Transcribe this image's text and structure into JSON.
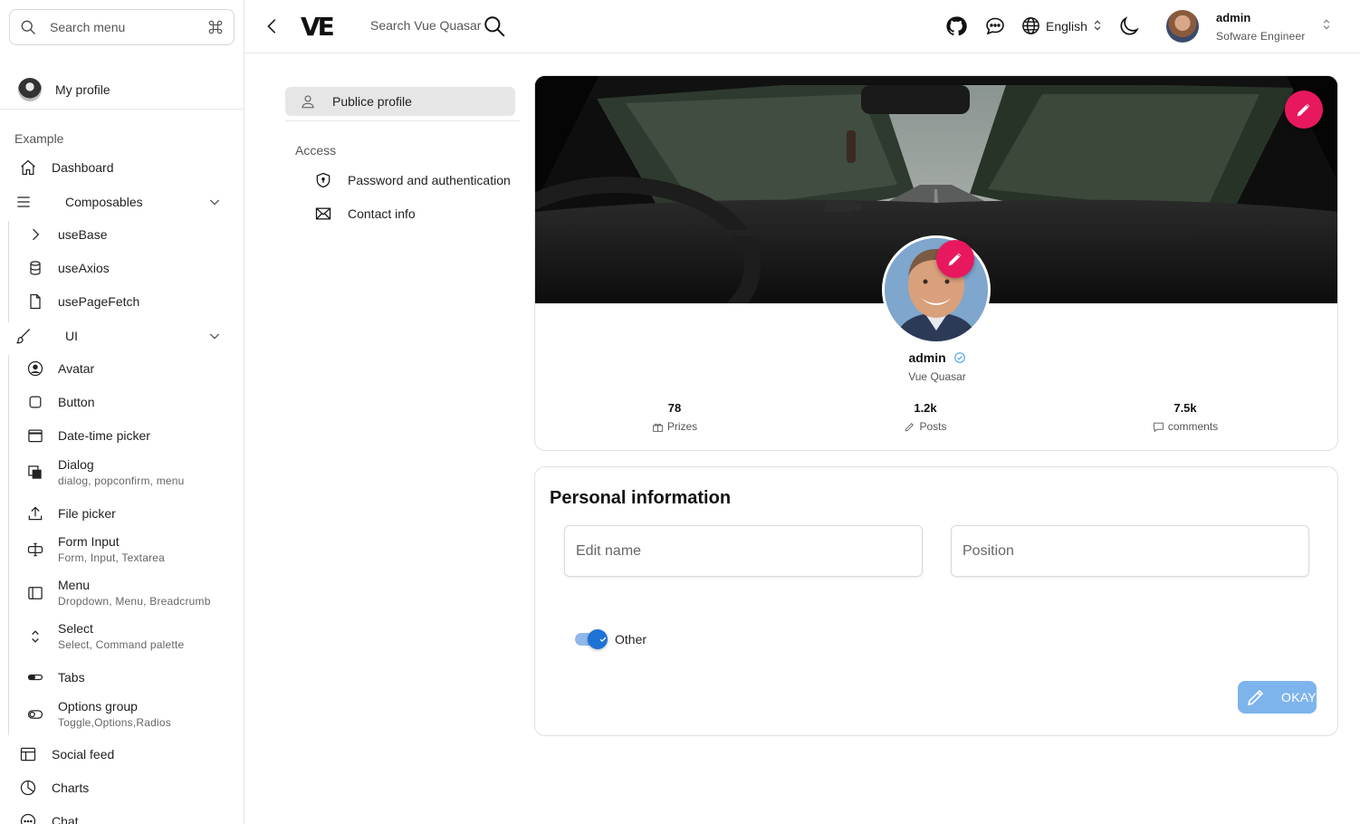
{
  "sidebar": {
    "search_placeholder": "Search menu",
    "profile_label": "My profile",
    "section_label": "Example",
    "items": {
      "dashboard": "Dashboard",
      "composables": "Composables",
      "use_base": "useBase",
      "use_axios": "useAxios",
      "use_page_fetch": "usePageFetch",
      "ui": "UI",
      "avatar": "Avatar",
      "button": "Button",
      "date_time_picker": "Date-time picker",
      "dialog": "Dialog",
      "dialog_sub": "dialog, popconfirm, menu",
      "file_picker": "File picker",
      "form_input": "Form Input",
      "form_input_sub": "Form, Input, Textarea",
      "menu": "Menu",
      "menu_sub": "Dropdown, Menu, Breadcrumb",
      "select": "Select",
      "select_sub": "Select, Command palette",
      "tabs": "Tabs",
      "options_group": "Options group",
      "options_group_sub": "Toggle,Options,Radios",
      "social_feed": "Social feed",
      "charts": "Charts",
      "chat": "Chat"
    }
  },
  "topbar": {
    "logo": "VE",
    "search_label": "Search Vue Quasar",
    "language": "English",
    "user_name": "admin",
    "user_role": "Sofware Engineer"
  },
  "settings_menu": {
    "active": "Publice profile",
    "section": "Access",
    "password": "Password and authentication",
    "contact": "Contact info"
  },
  "profile": {
    "name": "admin",
    "role": "Vue Quasar",
    "stats": [
      {
        "value": "78",
        "label": "Prizes"
      },
      {
        "value": "1.2k",
        "label": "Posts"
      },
      {
        "value": "7.5k",
        "label": "comments"
      }
    ]
  },
  "personal_info": {
    "title": "Personal information",
    "name_placeholder": "Edit name",
    "position_placeholder": "Position",
    "toggle_label": "Other",
    "toggle_on": true,
    "okay_label": "OKAY"
  },
  "colors": {
    "accent_pink": "#e8185f",
    "toggle_blue": "#1e72d6",
    "button_blue": "#7eb4ec"
  }
}
